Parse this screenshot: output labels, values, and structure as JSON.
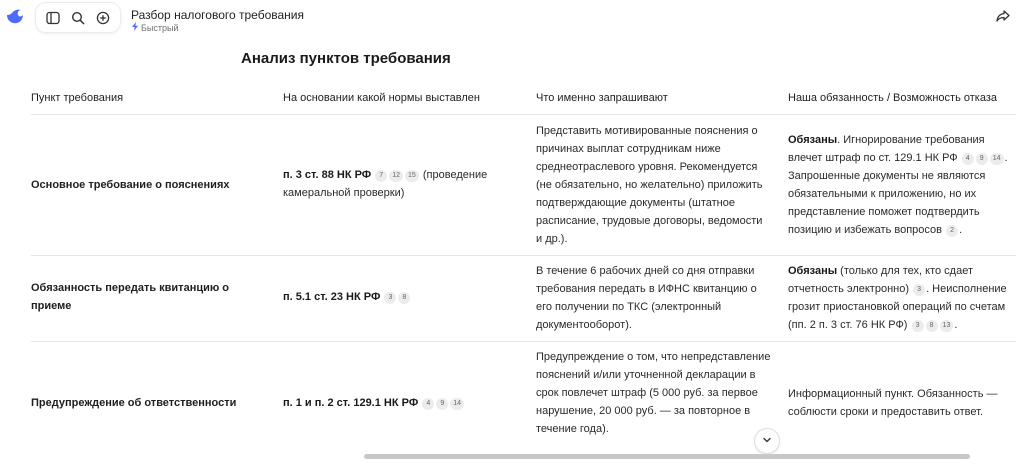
{
  "app": {
    "logo_icon": "whale-logo-icon",
    "accent": "#4d6bfe"
  },
  "toolbar": {
    "sidebar_icon": "sidebar-toggle-icon",
    "search_icon": "search-icon",
    "new_chat_icon": "plus-circle-icon"
  },
  "chat": {
    "title": "Разбор налогового требования",
    "mode": "Быстрый",
    "mode_icon": "lightning-icon",
    "share_icon": "share-icon"
  },
  "heading": "Анализ пунктов требования",
  "table": {
    "headers": [
      "Пункт требования",
      "На основании какой нормы выставлен",
      "Что именно запрашивают",
      "Наша обязанность / Возможность отказа"
    ],
    "rows": [
      {
        "item": "Основное требование о пояснениях",
        "norm": "п. 3 ст. 88 НК РФ",
        "norm_cites": [
          "7",
          "12",
          "15"
        ],
        "norm_tail": "(проведение камеральной проверки)",
        "request": "Представить мотивированные пояснения о причинах выплат сотрудникам ниже среднеотраслевого уровня. Рекомендуется (не обязательно, но желательно) приложить подтверждающие документы (штатное расписание, трудовые договоры, ведомости и др.).",
        "duty_bold": "Обязаны",
        "duty_a": ". Игнорирование требования влечет штраф по ст. 129.1 НК РФ",
        "duty_a_cites": [
          "4",
          "9",
          "14"
        ],
        "duty_b": ". Запрошенные документы не являются обязательными к приложению, но их представление поможет подтвердить позицию и избежать вопросов",
        "duty_b_cites": [
          "2"
        ],
        "duty_end": "."
      },
      {
        "item": "Обязанность передать квитанцию о приеме",
        "norm": "п. 5.1 ст. 23 НК РФ",
        "norm_cites": [
          "3",
          "8"
        ],
        "request": "В течение 6 рабочих дней со дня отправки требования передать в ИФНС квитанцию о его получении по ТКС (электронный документооборот).",
        "duty_bold": "Обязаны",
        "duty_a": " (только для тех, кто сдает отчетность электронно)",
        "duty_a_cites": [
          "3"
        ],
        "duty_b": ". Неисполнение грозит приостановкой операций по счетам (пп. 2 п. 3 ст. 76 НК РФ)",
        "duty_b_cites": [
          "3",
          "8",
          "13"
        ],
        "duty_end": "."
      },
      {
        "item": "Предупреждение об ответственности",
        "norm": "п. 1 и п. 2 ст. 129.1 НК РФ",
        "norm_cites": [
          "4",
          "9",
          "14"
        ],
        "request": "Предупреждение о том, что непредставление пояснений и/или уточненной декларации в срок повлечет штраф (5 000 руб. за первое нарушение, 20 000 руб. — за повторное в течение года).",
        "duty": "Информационный пункт. Обязанность — соблюсти сроки и предоставить ответ."
      }
    ]
  },
  "scroll_down_icon": "chevron-down-icon"
}
